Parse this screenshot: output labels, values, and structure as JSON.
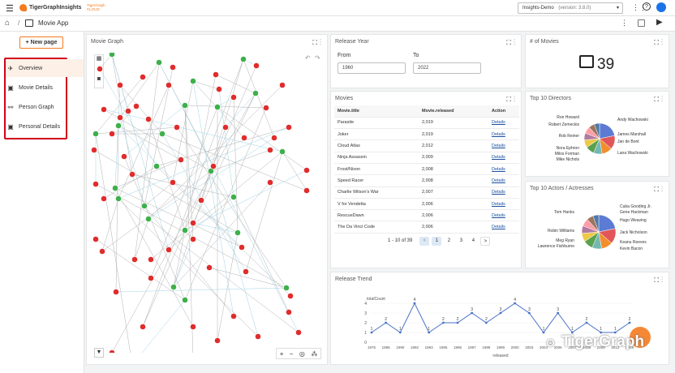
{
  "topbar": {
    "brand": "TigerGraphInsights",
    "cloud_brand": "TigerGraph CLOUD",
    "app_select": "Insights-Demo",
    "version": "(version: 3.8.0)"
  },
  "subbar": {
    "breadcrumb_separator": "/",
    "app_title": "Movie App"
  },
  "sidebar": {
    "new_page_label": "+ New page",
    "items": [
      {
        "label": "Overview",
        "icon": "compass-icon"
      },
      {
        "label": "Movie Details",
        "icon": "film-icon"
      },
      {
        "label": "Person Graph",
        "icon": "graph-icon"
      },
      {
        "label": "Personal Details",
        "icon": "film-icon"
      }
    ]
  },
  "movie_graph": {
    "title": "Movie Graph"
  },
  "release_year": {
    "title": "Release Year",
    "from_label": "From",
    "from_value": "1960",
    "to_label": "To",
    "to_value": "2022"
  },
  "num_movies": {
    "title": "# of Movies",
    "value": "39"
  },
  "movies_table": {
    "title": "Movies",
    "columns": [
      "Movie.title",
      "Movie.released",
      "Action"
    ],
    "rows": [
      [
        "Parasite",
        "2,019",
        "Details"
      ],
      [
        "Joker",
        "2,019",
        "Details"
      ],
      [
        "Cloud Atlas",
        "2,012",
        "Details"
      ],
      [
        "Ninja Assassin",
        "2,009",
        "Details"
      ],
      [
        "Frost/Nixon",
        "2,008",
        "Details"
      ],
      [
        "Speed Racer",
        "2,008",
        "Details"
      ],
      [
        "Charlie Wilson's War",
        "2,007",
        "Details"
      ],
      [
        "V for Vendetta",
        "2,006",
        "Details"
      ],
      [
        "RescueDawn",
        "2,006",
        "Details"
      ],
      [
        "The Da Vinci Code",
        "2,006",
        "Details"
      ]
    ],
    "pagination": {
      "summary": "1 - 10 of 39",
      "prev": "<",
      "next": ">",
      "pages": [
        "1",
        "2",
        "3",
        "4"
      ]
    }
  },
  "top_directors": {
    "title": "Top 10 Directors",
    "labels_left": [
      "Ron Howard",
      "Robert Zemeckis",
      "Rob Reiner",
      "Nora Ephron",
      "Milos Forman",
      "Mike Nichols"
    ],
    "labels_right": [
      "Andy Wachowski",
      "James Marshall",
      "Jan de Bont",
      "Lana Wachowski"
    ],
    "colors": [
      "#5b7bd5",
      "#e15759",
      "#f28e2b",
      "#76b7b2",
      "#59a14f",
      "#edc948",
      "#b07aa1",
      "#ff9da7",
      "#9c755f",
      "#4e79a7"
    ]
  },
  "top_actors": {
    "title": "Top 10 Actors / Actresses",
    "labels_left": [
      "Tom Hanks",
      "Robin Williams",
      "Meg Ryan",
      "Lawrence Fishburne"
    ],
    "labels_right": [
      "Cuba Gooding Jr.",
      "Gene Hackman",
      "Hugo Weaving",
      "Jack Nicholson",
      "Keanu Reeves",
      "Kevin Bacon"
    ],
    "colors": [
      "#5b7bd5",
      "#e15759",
      "#f28e2b",
      "#76b7b2",
      "#59a14f",
      "#edc948",
      "#b07aa1",
      "#ff9da7",
      "#9c755f",
      "#4e79a7"
    ]
  },
  "release_trend": {
    "title": "Release Trend"
  },
  "chart_data": {
    "type": "line",
    "ylabel": "totalCount",
    "xlabel": "released",
    "x": [
      "1975",
      "1986",
      "1990",
      "1992",
      "1993",
      "1995",
      "1996",
      "1997",
      "1998",
      "1999",
      "2000",
      "2003",
      "2004",
      "2006",
      "2007",
      "2008",
      "2009",
      "2012",
      "2019"
    ],
    "values": [
      1,
      2,
      1,
      4,
      1,
      2,
      2,
      3,
      2,
      3,
      4,
      3,
      1,
      3,
      1,
      2,
      1,
      1,
      2
    ],
    "ylim": [
      0,
      4
    ],
    "yticks": [
      0,
      1,
      2,
      3,
      4
    ],
    "color": "#4a72c9"
  },
  "watermark": "TigerGraph"
}
